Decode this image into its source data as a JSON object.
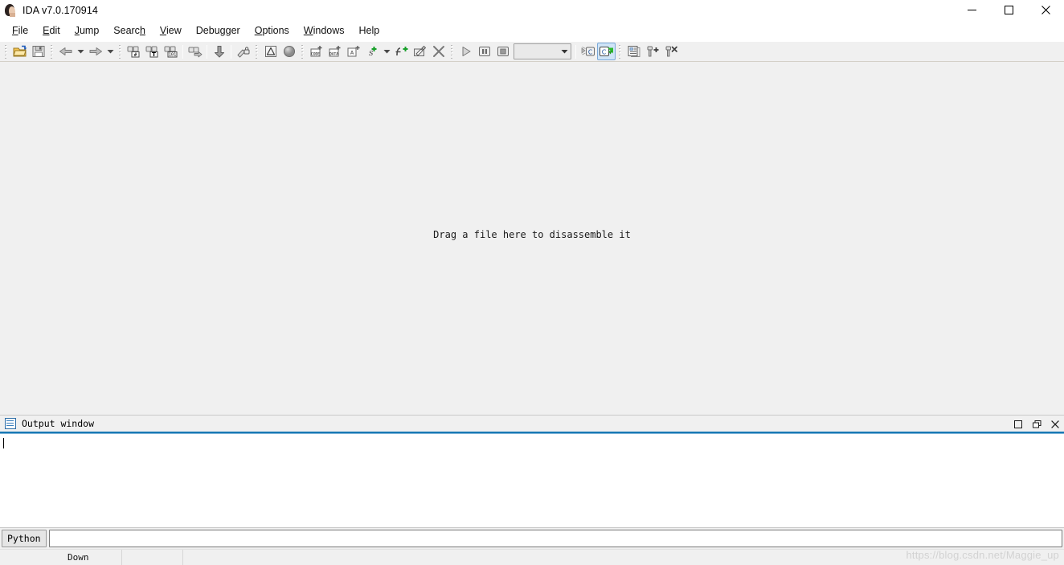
{
  "window": {
    "title": "IDA v7.0.170914",
    "app_icon": "ida-face-icon",
    "controls": {
      "minimize": "minimize-icon",
      "maximize": "maximize-icon",
      "close": "close-icon"
    }
  },
  "menubar": {
    "items": [
      {
        "label": "File",
        "mnemonic": "F"
      },
      {
        "label": "Edit",
        "mnemonic": "E"
      },
      {
        "label": "Jump",
        "mnemonic": "J"
      },
      {
        "label": "Search",
        "mnemonic": "h"
      },
      {
        "label": "View",
        "mnemonic": "V"
      },
      {
        "label": "Debugger",
        "mnemonic": "g"
      },
      {
        "label": "Options",
        "mnemonic": "O"
      },
      {
        "label": "Windows",
        "mnemonic": "W"
      },
      {
        "label": "Help",
        "mnemonic": ""
      }
    ]
  },
  "toolbar": {
    "groups": [
      {
        "name": "file",
        "buttons": [
          {
            "icon": "open-folder-icon",
            "label": "Open"
          },
          {
            "icon": "save-disk-icon",
            "label": "Save"
          }
        ]
      },
      {
        "name": "navigation",
        "buttons": [
          {
            "icon": "back-arrow-icon",
            "label": "Jump back"
          },
          {
            "icon": "back-dropdown-icon",
            "label": "Jump back history"
          },
          {
            "icon": "forward-arrow-icon",
            "label": "Jump forward"
          },
          {
            "icon": "forward-dropdown-icon",
            "label": "Jump forward history"
          }
        ]
      },
      {
        "name": "search",
        "buttons": [
          {
            "icon": "search-hex-icon",
            "label": "Search for next hex value"
          },
          {
            "icon": "search-text-icon",
            "label": "Search for next text"
          },
          {
            "icon": "search-binary-icon",
            "label": "Search for next binary"
          },
          {
            "icon": "search-next-icon",
            "label": "Search again"
          },
          {
            "icon": "jump-down-icon",
            "label": "Jump to address"
          },
          {
            "icon": "unexplored-icon",
            "label": "Mark position"
          }
        ]
      },
      {
        "name": "analysis",
        "buttons": [
          {
            "icon": "warning-triangle-icon",
            "label": "Problems"
          },
          {
            "icon": "sphere-icon",
            "label": "Graph overview"
          }
        ]
      },
      {
        "name": "convert",
        "buttons": [
          {
            "icon": "make-code-icon",
            "label": "Make code"
          },
          {
            "icon": "make-data-icon",
            "label": "Make data"
          },
          {
            "icon": "make-array-icon",
            "label": "Make array"
          },
          {
            "icon": "make-struct-icon",
            "label": "Make struct"
          },
          {
            "icon": "struct-dropdown-icon",
            "label": "Struct options"
          },
          {
            "icon": "make-function-icon",
            "label": "Make function"
          },
          {
            "icon": "edit-function-icon",
            "label": "Edit function"
          },
          {
            "icon": "undefine-icon",
            "label": "Undefine"
          }
        ]
      },
      {
        "name": "debugger",
        "buttons": [
          {
            "icon": "run-play-icon",
            "label": "Start process"
          },
          {
            "icon": "pause-icon",
            "label": "Pause process"
          },
          {
            "icon": "stop-icon",
            "label": "Terminate process"
          }
        ],
        "combo": {
          "value": "",
          "placeholder": "",
          "icon": "chevron-down-icon"
        }
      },
      {
        "name": "decompile",
        "buttons": [
          {
            "icon": "decompile-off-icon",
            "label": "Decompile"
          },
          {
            "icon": "decompile-on-icon",
            "label": "Decompile function",
            "active": true
          }
        ]
      },
      {
        "name": "breakpoints",
        "buttons": [
          {
            "icon": "list-icon",
            "label": "Breakpoint list"
          },
          {
            "icon": "add-breakpoint-icon",
            "label": "Add breakpoint"
          },
          {
            "icon": "del-breakpoint-icon",
            "label": "Delete breakpoint"
          }
        ]
      }
    ]
  },
  "workspace": {
    "drop_hint": "Drag a file here to disassemble it"
  },
  "output_window": {
    "title": "Output window",
    "icon": "output-lines-icon",
    "buttons": [
      {
        "icon": "maximize-pane-icon",
        "label": "Maximize"
      },
      {
        "icon": "restore-pane-icon",
        "label": "Restore"
      },
      {
        "icon": "close-pane-icon",
        "label": "Close"
      }
    ],
    "content": "",
    "accent_color": "#1878b4"
  },
  "cli": {
    "language_button": "Python",
    "input_value": "",
    "input_placeholder": ""
  },
  "statusbar": {
    "cells": [
      "",
      "Down",
      "",
      ""
    ]
  },
  "watermark": {
    "text": "https://blog.csdn.net/Maggie_up"
  },
  "colors": {
    "window_bg": "#f0f0f0",
    "titlebar_bg": "#ffffff",
    "accent_blue": "#1878b4",
    "toolbar_active": "#cfe4f7"
  }
}
